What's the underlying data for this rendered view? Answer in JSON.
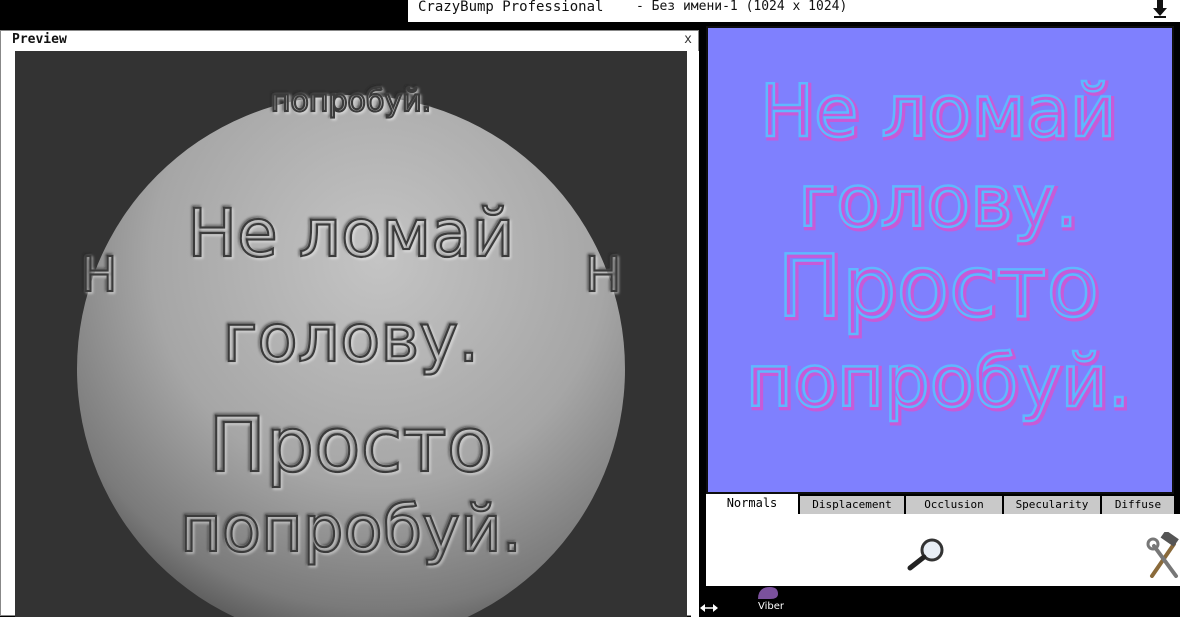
{
  "app": {
    "name": "CrazyBump Professional",
    "document": "- Без имени-1 (1024 x 1024)"
  },
  "preview": {
    "title": "Preview",
    "close": "x",
    "sphere_text": [
      "Не ломай",
      "голову.",
      "Просто",
      "попробуй."
    ],
    "top_wrap_text": "попробуй.",
    "left_fragment": "Н",
    "right_fragment": "Н"
  },
  "map": {
    "lines": [
      "Не ломай",
      "голову.",
      "Просто",
      "попробуй."
    ],
    "background_color": "#7f80fe"
  },
  "tabs": [
    {
      "label": "Normals",
      "active": true
    },
    {
      "label": "Displacement",
      "active": false
    },
    {
      "label": "Occlusion",
      "active": false
    },
    {
      "label": "Specularity",
      "active": false
    },
    {
      "label": "Diffuse",
      "active": false
    }
  ],
  "tools": {
    "magnifier": "magnifier-icon",
    "tools": "hammer-wrench-icon"
  },
  "taskbar": {
    "viber_label": "Viber"
  }
}
